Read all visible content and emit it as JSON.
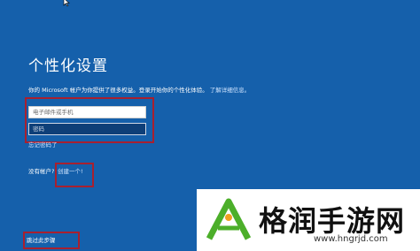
{
  "page": {
    "title": "个性化设置",
    "description_main": "你的 Microsoft 帐户为你提供了很多权益。登录开始你的个性化体验。",
    "description_link": "了解详细信息。"
  },
  "login": {
    "email_placeholder": "电子邮件或手机",
    "password_placeholder": "密码",
    "forgot_password": "忘记密码了",
    "no_account_text": "没有帐户?",
    "create_account": "创建一个!",
    "skip": "跳过此步骤"
  },
  "watermark": {
    "name": "格润手游网",
    "url": "www.hngrjd.com"
  },
  "colors": {
    "background": "#1560ab",
    "highlight": "#a8202f",
    "logo_green": "#4caf2a"
  }
}
